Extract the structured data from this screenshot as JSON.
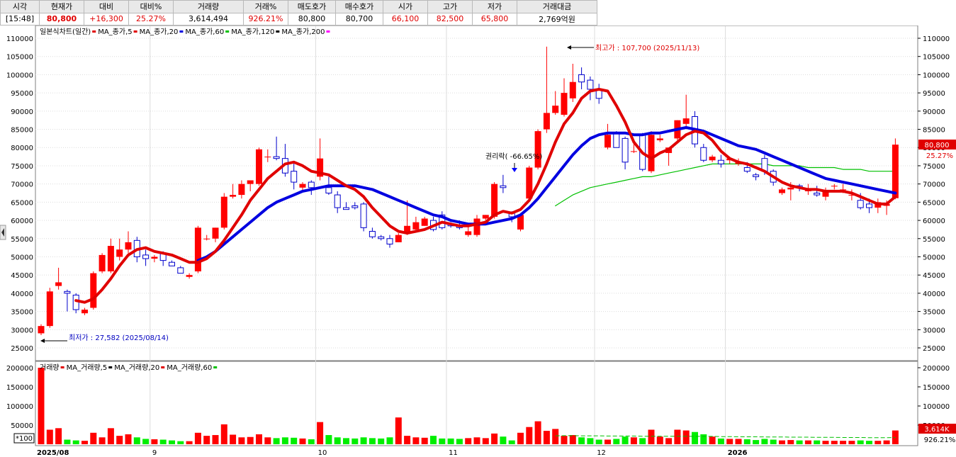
{
  "header": {
    "columns": [
      "시각",
      "현재가",
      "대비",
      "대비%",
      "거래량",
      "거래%",
      "매도호가",
      "매수호가",
      "시가",
      "고가",
      "저가",
      "거래대금"
    ],
    "values": [
      "[15:48]",
      "80,800",
      "+16,300",
      "25.27%",
      "3,614,494",
      "926.21%",
      "80,800",
      "80,700",
      "66,100",
      "82,500",
      "65,800",
      "2,769억원"
    ]
  },
  "legend": {
    "price": [
      {
        "label": "일본식차트(일간)",
        "color": "#e00000"
      },
      {
        "label": "MA_종가,5",
        "color": "#e00000"
      },
      {
        "label": "MA_종가,20",
        "color": "#0000e0"
      },
      {
        "label": "MA_종가,60",
        "color": "#00c000"
      },
      {
        "label": "MA_종가,120",
        "color": "#000000"
      },
      {
        "label": "MA_종가,200",
        "color": "#ff00ff"
      }
    ],
    "volume": [
      {
        "label": "거래량",
        "color": "#e00000"
      },
      {
        "label": "MA_거래량,5",
        "color": "#000000"
      },
      {
        "label": "MA_거래량,20",
        "color": "#e00000"
      },
      {
        "label": "MA_거래량,60",
        "color": "#00c000"
      }
    ]
  },
  "annotations": {
    "high": "최고가 : 107,700 (2025/11/13)",
    "low": "최저가 : 27,582 (2025/08/14)",
    "rights": "권리락( -66.65%)"
  },
  "current_price_tag": {
    "price": "80,800",
    "pct": "25.27%"
  },
  "volume_tag": {
    "value": "3,614K",
    "pct": "926.21%"
  },
  "vol_unit": "*100",
  "colors": {
    "up": "#ff0000",
    "down": "#0000ff",
    "ma5": "#e00000",
    "ma20": "#0000e0",
    "ma60": "#00c000",
    "volume_up": "#ff0000",
    "volume_down": "#00ee00"
  },
  "chart_data": {
    "type": "candlestick",
    "price_axis": {
      "min": 25000,
      "max": 110000,
      "ticks": [
        25000,
        30000,
        35000,
        40000,
        45000,
        50000,
        55000,
        60000,
        65000,
        70000,
        75000,
        80000,
        85000,
        90000,
        95000,
        100000,
        105000,
        110000
      ]
    },
    "volume_axis": {
      "min": 0,
      "max": 200000,
      "ticks": [
        50000,
        100000,
        150000,
        200000
      ]
    },
    "x_labels": [
      "2025/08",
      "9",
      "10",
      "11",
      "12",
      "2026"
    ],
    "month_start_index": [
      0,
      13,
      32,
      47,
      64,
      79
    ],
    "candles": [
      [
        29000,
        31500,
        28500,
        31000
      ],
      [
        31000,
        41500,
        30500,
        40500
      ],
      [
        42000,
        47000,
        41000,
        43000
      ],
      [
        40500,
        41000,
        35000,
        40000
      ],
      [
        39500,
        40000,
        34500,
        35500
      ],
      [
        34500,
        36000,
        34000,
        35500
      ],
      [
        36000,
        46000,
        35500,
        45500
      ],
      [
        46000,
        51000,
        45500,
        50500
      ],
      [
        46000,
        55000,
        45500,
        53000
      ],
      [
        50000,
        55000,
        49000,
        52000
      ],
      [
        52000,
        57000,
        51000,
        54000
      ],
      [
        54500,
        55500,
        48500,
        50000
      ],
      [
        50500,
        52000,
        47500,
        49500
      ],
      [
        49500,
        50500,
        48500,
        50000
      ],
      [
        51000,
        51500,
        47500,
        49000
      ],
      [
        48500,
        49000,
        47500,
        47500
      ],
      [
        47000,
        47500,
        45500,
        45500
      ],
      [
        44500,
        45500,
        44000,
        45000
      ],
      [
        46000,
        58500,
        45500,
        58000
      ],
      [
        55000,
        56000,
        54500,
        55000
      ],
      [
        55000,
        58000,
        54000,
        58000
      ],
      [
        58000,
        67500,
        57500,
        66500
      ],
      [
        66500,
        70000,
        66000,
        67000
      ],
      [
        67000,
        71000,
        66000,
        70000
      ],
      [
        70000,
        71000,
        68000,
        71000
      ],
      [
        70000,
        80000,
        69500,
        79500
      ],
      [
        77500,
        79500,
        76000,
        77500
      ],
      [
        77500,
        83000,
        76500,
        77000
      ],
      [
        77000,
        81000,
        72000,
        73000
      ],
      [
        73500,
        76000,
        68500,
        70500
      ],
      [
        69000,
        70500,
        68000,
        70000
      ],
      [
        70500,
        71000,
        67000,
        69000
      ],
      [
        72000,
        82500,
        71000,
        77000
      ],
      [
        69000,
        72000,
        67000,
        67500
      ],
      [
        67000,
        68000,
        62000,
        63500
      ],
      [
        63500,
        65000,
        63000,
        63000
      ],
      [
        64000,
        65000,
        63000,
        63500
      ],
      [
        64500,
        65000,
        57000,
        58000
      ],
      [
        57000,
        58000,
        55000,
        55500
      ],
      [
        55500,
        56000,
        54500,
        55000
      ],
      [
        55000,
        56000,
        52500,
        53500
      ],
      [
        54000,
        56500,
        54000,
        56000
      ],
      [
        56500,
        65500,
        56000,
        58500
      ],
      [
        57500,
        61000,
        57000,
        59500
      ],
      [
        58500,
        61000,
        58500,
        60500
      ],
      [
        60000,
        61000,
        57000,
        57500
      ],
      [
        61500,
        62500,
        57500,
        58000
      ],
      [
        59000,
        59500,
        58000,
        58500
      ],
      [
        58500,
        60000,
        57500,
        58000
      ],
      [
        56000,
        59000,
        55500,
        57000
      ],
      [
        56000,
        61500,
        55500,
        60500
      ],
      [
        60500,
        61500,
        60000,
        61500
      ],
      [
        61000,
        70500,
        60500,
        70000
      ],
      [
        69500,
        72500,
        67500,
        69000
      ],
      [
        62000,
        62500,
        59500,
        61000
      ],
      [
        57500,
        62000,
        57000,
        61500
      ],
      [
        66000,
        75000,
        65500,
        74500
      ],
      [
        74500,
        85000,
        74000,
        84500
      ],
      [
        85000,
        107700,
        84000,
        89500
      ],
      [
        89500,
        95500,
        89000,
        91500
      ],
      [
        89000,
        99000,
        88500,
        95000
      ],
      [
        93500,
        103000,
        92500,
        98000
      ],
      [
        100000,
        102000,
        96000,
        98000
      ],
      [
        98500,
        99500,
        93000,
        96000
      ],
      [
        96000,
        97500,
        92000,
        93500
      ],
      [
        80000,
        86500,
        79500,
        83500
      ],
      [
        84000,
        84500,
        80000,
        80000
      ],
      [
        82500,
        83000,
        74000,
        76000
      ],
      [
        79000,
        81500,
        78500,
        79000
      ],
      [
        83500,
        84000,
        73500,
        74000
      ],
      [
        73500,
        84500,
        73000,
        83500
      ],
      [
        82000,
        83500,
        81500,
        82500
      ],
      [
        78500,
        80000,
        75000,
        80000
      ],
      [
        82500,
        87500,
        82000,
        87500
      ],
      [
        86500,
        94500,
        85500,
        88000
      ],
      [
        88500,
        90000,
        80000,
        81000
      ],
      [
        80000,
        81000,
        76000,
        76500
      ],
      [
        76500,
        78000,
        76000,
        77500
      ],
      [
        76500,
        78000,
        74500,
        75500
      ],
      [
        76500,
        77500,
        75500,
        77000
      ],
      [
        75500,
        77000,
        75000,
        76000
      ],
      [
        74500,
        76000,
        73000,
        73500
      ],
      [
        72500,
        73000,
        71000,
        72000
      ],
      [
        77000,
        78000,
        72500,
        73500
      ],
      [
        73500,
        74000,
        69500,
        70500
      ],
      [
        67500,
        69000,
        67000,
        68500
      ],
      [
        68500,
        70500,
        65500,
        69000
      ],
      [
        69500,
        70000,
        68000,
        69000
      ],
      [
        68000,
        70000,
        67000,
        68500
      ],
      [
        67500,
        69500,
        66500,
        67000
      ],
      [
        66500,
        69000,
        65500,
        68000
      ],
      [
        69500,
        70000,
        68500,
        69500
      ],
      [
        68500,
        70000,
        67500,
        68500
      ],
      [
        67000,
        68500,
        65500,
        67000
      ],
      [
        65500,
        67500,
        63000,
        63500
      ],
      [
        64500,
        66000,
        62000,
        63500
      ],
      [
        63500,
        66000,
        62000,
        65000
      ],
      [
        64000,
        65500,
        61500,
        64500
      ],
      [
        66100,
        82500,
        65800,
        80800
      ]
    ],
    "ma5": [
      null,
      null,
      null,
      null,
      38000,
      37500,
      38500,
      41000,
      44000,
      47500,
      50500,
      52000,
      52500,
      51500,
      51000,
      50500,
      49500,
      48500,
      48500,
      49500,
      51500,
      54500,
      58000,
      61500,
      65500,
      68500,
      71500,
      73500,
      75500,
      76000,
      75000,
      73500,
      73000,
      72500,
      71000,
      69500,
      68500,
      66500,
      63500,
      61000,
      58500,
      57000,
      56500,
      57000,
      57500,
      58500,
      59500,
      59000,
      58500,
      58500,
      59000,
      59500,
      61500,
      62500,
      62000,
      63000,
      65500,
      70000,
      75500,
      81500,
      86500,
      89500,
      93500,
      95500,
      96000,
      95500,
      91500,
      87000,
      81500,
      78500,
      77000,
      78500,
      79500,
      81500,
      83500,
      84500,
      84000,
      82000,
      79000,
      77000,
      76000,
      75500,
      74500,
      73500,
      72000,
      70500,
      69500,
      69000,
      68500,
      68500,
      68000,
      68000,
      68000,
      67500,
      66500,
      65500,
      64500,
      64500,
      66500
    ],
    "ma20": [
      null,
      null,
      null,
      null,
      null,
      null,
      null,
      null,
      null,
      null,
      null,
      null,
      null,
      null,
      null,
      null,
      null,
      null,
      49000,
      50000,
      51500,
      53500,
      55500,
      57500,
      59500,
      61500,
      63500,
      65000,
      66000,
      67000,
      68000,
      68500,
      69000,
      69500,
      69500,
      69500,
      69500,
      69000,
      68500,
      67500,
      66500,
      65500,
      64500,
      63500,
      62500,
      61500,
      61000,
      60000,
      59500,
      59000,
      59000,
      59000,
      59500,
      60000,
      60500,
      61500,
      63500,
      66000,
      69000,
      72000,
      75000,
      78000,
      80500,
      82500,
      83500,
      84000,
      84000,
      84000,
      83500,
      83500,
      84000,
      84000,
      84500,
      85000,
      85500,
      85000,
      84500,
      83500,
      82500,
      81500,
      80500,
      80000,
      79500,
      78500,
      77500,
      76500,
      75500,
      74500,
      73500,
      72500,
      71500,
      71000,
      70500,
      70000,
      69500,
      69000,
      68500,
      68000,
      67500
    ],
    "ma60": [
      null,
      null,
      null,
      null,
      null,
      null,
      null,
      null,
      null,
      null,
      null,
      null,
      null,
      null,
      null,
      null,
      null,
      null,
      null,
      null,
      null,
      null,
      null,
      null,
      null,
      null,
      null,
      null,
      null,
      null,
      null,
      null,
      null,
      null,
      null,
      null,
      null,
      null,
      null,
      null,
      null,
      null,
      null,
      null,
      null,
      null,
      null,
      null,
      null,
      null,
      null,
      null,
      null,
      null,
      null,
      null,
      null,
      null,
      null,
      64000,
      65500,
      67000,
      68000,
      69000,
      69500,
      70000,
      70500,
      71000,
      71500,
      72000,
      72000,
      72500,
      73000,
      73500,
      74000,
      74500,
      75000,
      75500,
      75500,
      75500,
      75500,
      75500,
      75500,
      75500,
      75000,
      75000,
      75000,
      75000,
      74500,
      74500,
      74500,
      74500,
      74000,
      74000,
      74000,
      73500,
      73500,
      73500,
      73500
    ],
    "volume": [
      200000,
      38000,
      42000,
      12000,
      10000,
      9000,
      30000,
      18000,
      42000,
      22000,
      26000,
      18000,
      14000,
      13000,
      12000,
      10000,
      8000,
      8000,
      30000,
      22000,
      24000,
      52000,
      25000,
      18000,
      19000,
      26000,
      18000,
      16000,
      18000,
      17000,
      15000,
      13000,
      58000,
      24000,
      18000,
      16000,
      15000,
      18000,
      16000,
      15000,
      18000,
      70000,
      22000,
      18000,
      17000,
      22000,
      15000,
      15000,
      14000,
      16000,
      18000,
      16000,
      28000,
      20000,
      10000,
      30000,
      45000,
      60000,
      35000,
      40000,
      22000,
      24000,
      18000,
      16000,
      12000,
      12000,
      14000,
      20000,
      18000,
      16000,
      38000,
      20000,
      16000,
      38000,
      36000,
      32000,
      26000,
      20000,
      15000,
      14000,
      14000,
      13000,
      11000,
      14000,
      12000,
      10000,
      11000,
      10000,
      10000,
      10000,
      9000,
      9000,
      9000,
      9000,
      10000,
      9000,
      9000,
      10000,
      36000
    ],
    "volume_ma60": [
      null,
      null,
      null,
      null,
      null,
      null,
      null,
      null,
      null,
      null,
      null,
      null,
      null,
      null,
      null,
      null,
      null,
      null,
      null,
      null,
      null,
      null,
      null,
      null,
      null,
      null,
      null,
      null,
      null,
      null,
      null,
      null,
      null,
      null,
      null,
      null,
      null,
      null,
      null,
      null,
      null,
      null,
      null,
      null,
      null,
      null,
      null,
      null,
      null,
      null,
      null,
      null,
      null,
      null,
      null,
      null,
      null,
      null,
      null,
      22000,
      22500,
      22500,
      22000,
      22000,
      22000,
      21500,
      21500,
      21500,
      21500,
      21000,
      21000,
      21000,
      21000,
      21000,
      21000,
      20500,
      20500,
      20500,
      20000,
      20000,
      19500,
      19500,
      19500,
      19000,
      19000,
      19000,
      18500,
      18500,
      18500,
      18000,
      18000,
      18000,
      17500,
      17500,
      17500,
      17000,
      17000,
      17000,
      17500
    ]
  }
}
